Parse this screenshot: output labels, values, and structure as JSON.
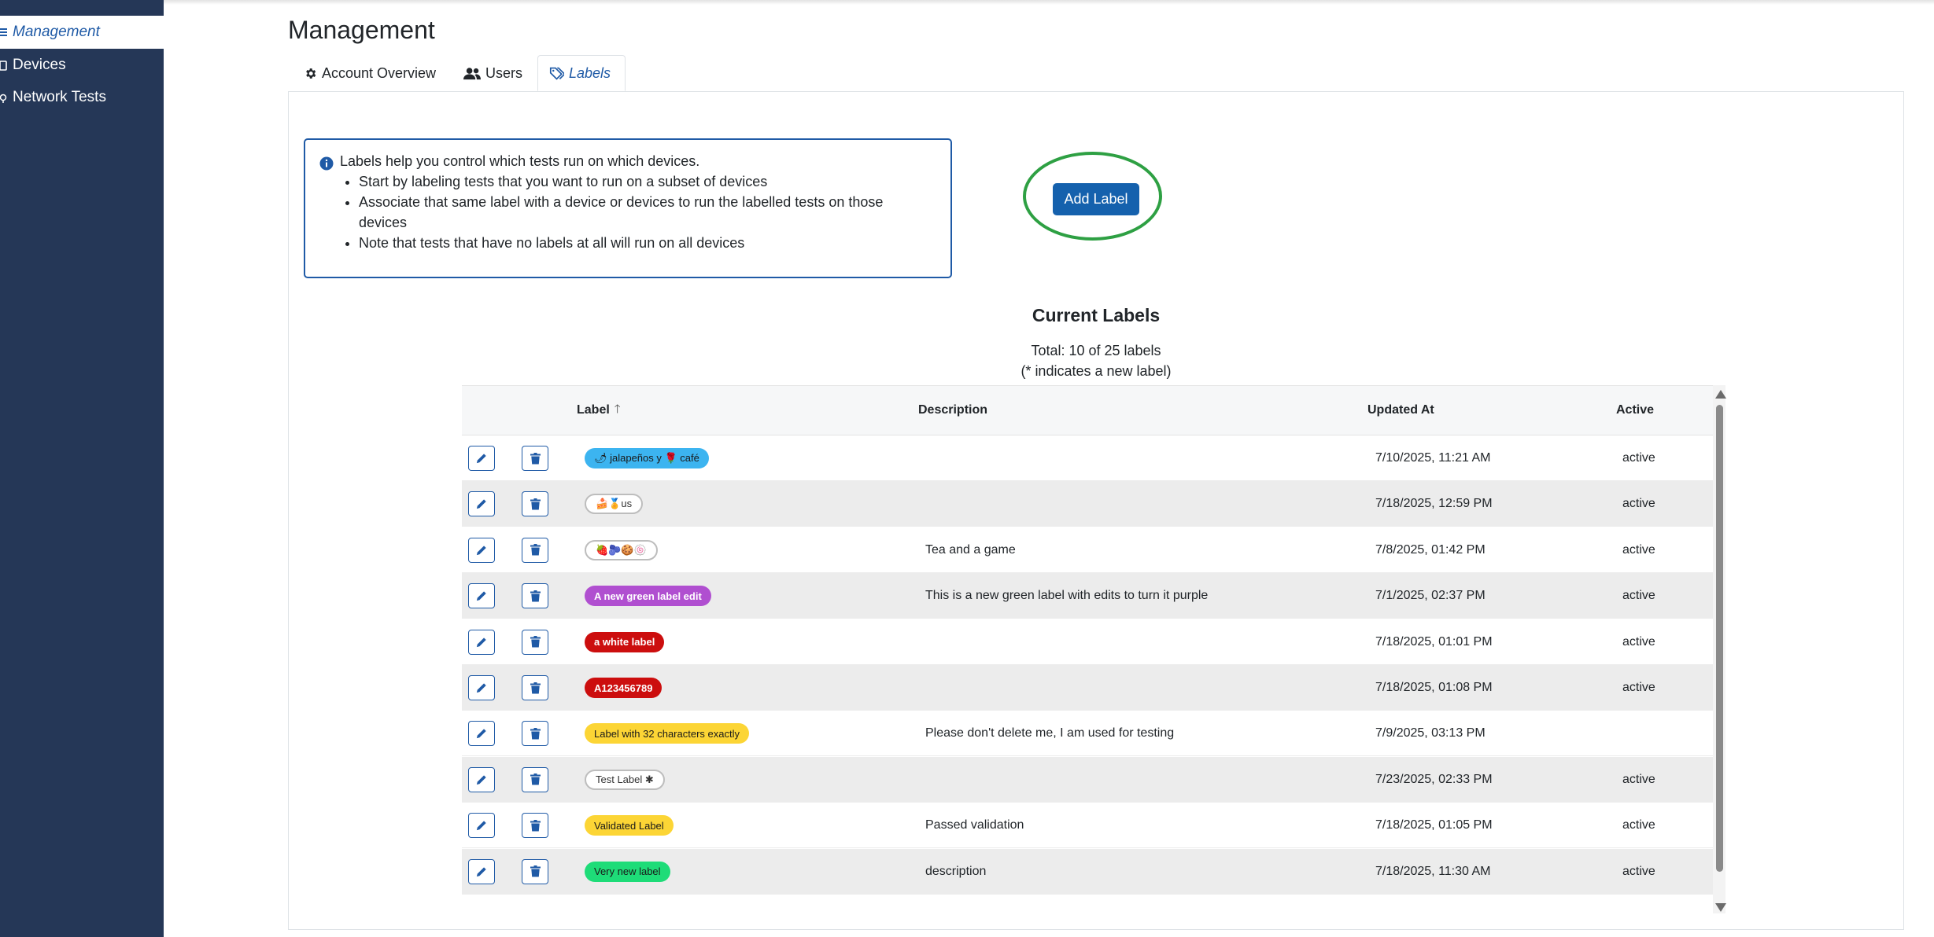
{
  "sidebar": {
    "items": [
      {
        "label": "Management",
        "icon": "list-icon",
        "active": true
      },
      {
        "label": "Devices",
        "icon": "device-icon",
        "active": false
      },
      {
        "label": "Network Tests",
        "icon": "network-icon",
        "active": false
      }
    ]
  },
  "page": {
    "title": "Management"
  },
  "tabs": [
    {
      "label": "Account Overview",
      "icon": "gear-icon",
      "active": false
    },
    {
      "label": "Users",
      "icon": "users-icon",
      "active": false
    },
    {
      "label": "Labels",
      "icon": "tags-icon",
      "active": true
    }
  ],
  "info": {
    "icon": "info-circle-icon",
    "heading": "Labels help you control which tests run on which devices.",
    "bullets": [
      "Start by labeling tests that you want to run on a subset of devices",
      "Associate that same label with a device or devices to run the labelled tests on those devices",
      "Note that tests that have no labels at all will run on all devices"
    ]
  },
  "actions": {
    "add_label": "Add Label",
    "highlight_color": "#2ea043",
    "button_color": "#1561ad"
  },
  "labels_section": {
    "title": "Current Labels",
    "total": "Total: 10 of 25 labels",
    "new_note": "(* indicates a new label)"
  },
  "table": {
    "columns": {
      "label": "Label",
      "description": "Description",
      "updated_at": "Updated At",
      "active": "Active"
    },
    "sort": {
      "column": "label",
      "direction": "ascending",
      "icon": "arrow-up-icon"
    },
    "row_icons": {
      "edit": "pencil-icon",
      "delete": "trash-icon"
    },
    "rows": [
      {
        "label": "🌶 jalapeños y 🌹 café",
        "color": "#3cb4f0",
        "text_color": "#1a1a1a",
        "bold": false,
        "outline": false,
        "description": "",
        "updated_at": "7/10/2025, 11:21 AM",
        "active": "active"
      },
      {
        "label": "🍰🏅us",
        "color": "#ffffff",
        "text_color": "#333333",
        "bold": false,
        "outline": true,
        "description": "",
        "updated_at": "7/18/2025, 12:59 PM",
        "active": "active"
      },
      {
        "label": "🍓🫐🍪🍥",
        "color": "#ffffff",
        "text_color": "#333333",
        "bold": false,
        "outline": true,
        "description": "Tea and a game",
        "updated_at": "7/8/2025, 01:42 PM",
        "active": "active"
      },
      {
        "label": "A new green label edit",
        "color": "#b04fd0",
        "text_color": "#ffffff",
        "bold": true,
        "outline": false,
        "description": "This is a new green label with edits to turn it purple",
        "updated_at": "7/1/2025, 02:37 PM",
        "active": "active"
      },
      {
        "label": "a white label",
        "color": "#cc0e0e",
        "text_color": "#ffffff",
        "bold": true,
        "outline": false,
        "description": "",
        "updated_at": "7/18/2025, 01:01 PM",
        "active": "active"
      },
      {
        "label": "A123456789",
        "color": "#cc0e0e",
        "text_color": "#ffffff",
        "bold": true,
        "outline": false,
        "description": "",
        "updated_at": "7/18/2025, 01:08 PM",
        "active": "active"
      },
      {
        "label": "Label with 32 characters exactly",
        "color": "#fcd535",
        "text_color": "#1a1a1a",
        "bold": false,
        "outline": false,
        "description": "Please don't delete me, I am used for testing",
        "updated_at": "7/9/2025, 03:13 PM",
        "active": ""
      },
      {
        "label": "Test Label ✱",
        "color": "#ffffff",
        "text_color": "#333333",
        "bold": false,
        "outline": true,
        "description": "",
        "updated_at": "7/23/2025, 02:33 PM",
        "active": "active"
      },
      {
        "label": "Validated Label",
        "color": "#fcd535",
        "text_color": "#1a1a1a",
        "bold": false,
        "outline": false,
        "description": "Passed validation",
        "updated_at": "7/18/2025, 01:05 PM",
        "active": "active"
      },
      {
        "label": "Very new label",
        "color": "#1edc78",
        "text_color": "#1a1a1a",
        "bold": false,
        "outline": false,
        "description": "description",
        "updated_at": "7/18/2025, 11:30 AM",
        "active": "active"
      }
    ]
  }
}
